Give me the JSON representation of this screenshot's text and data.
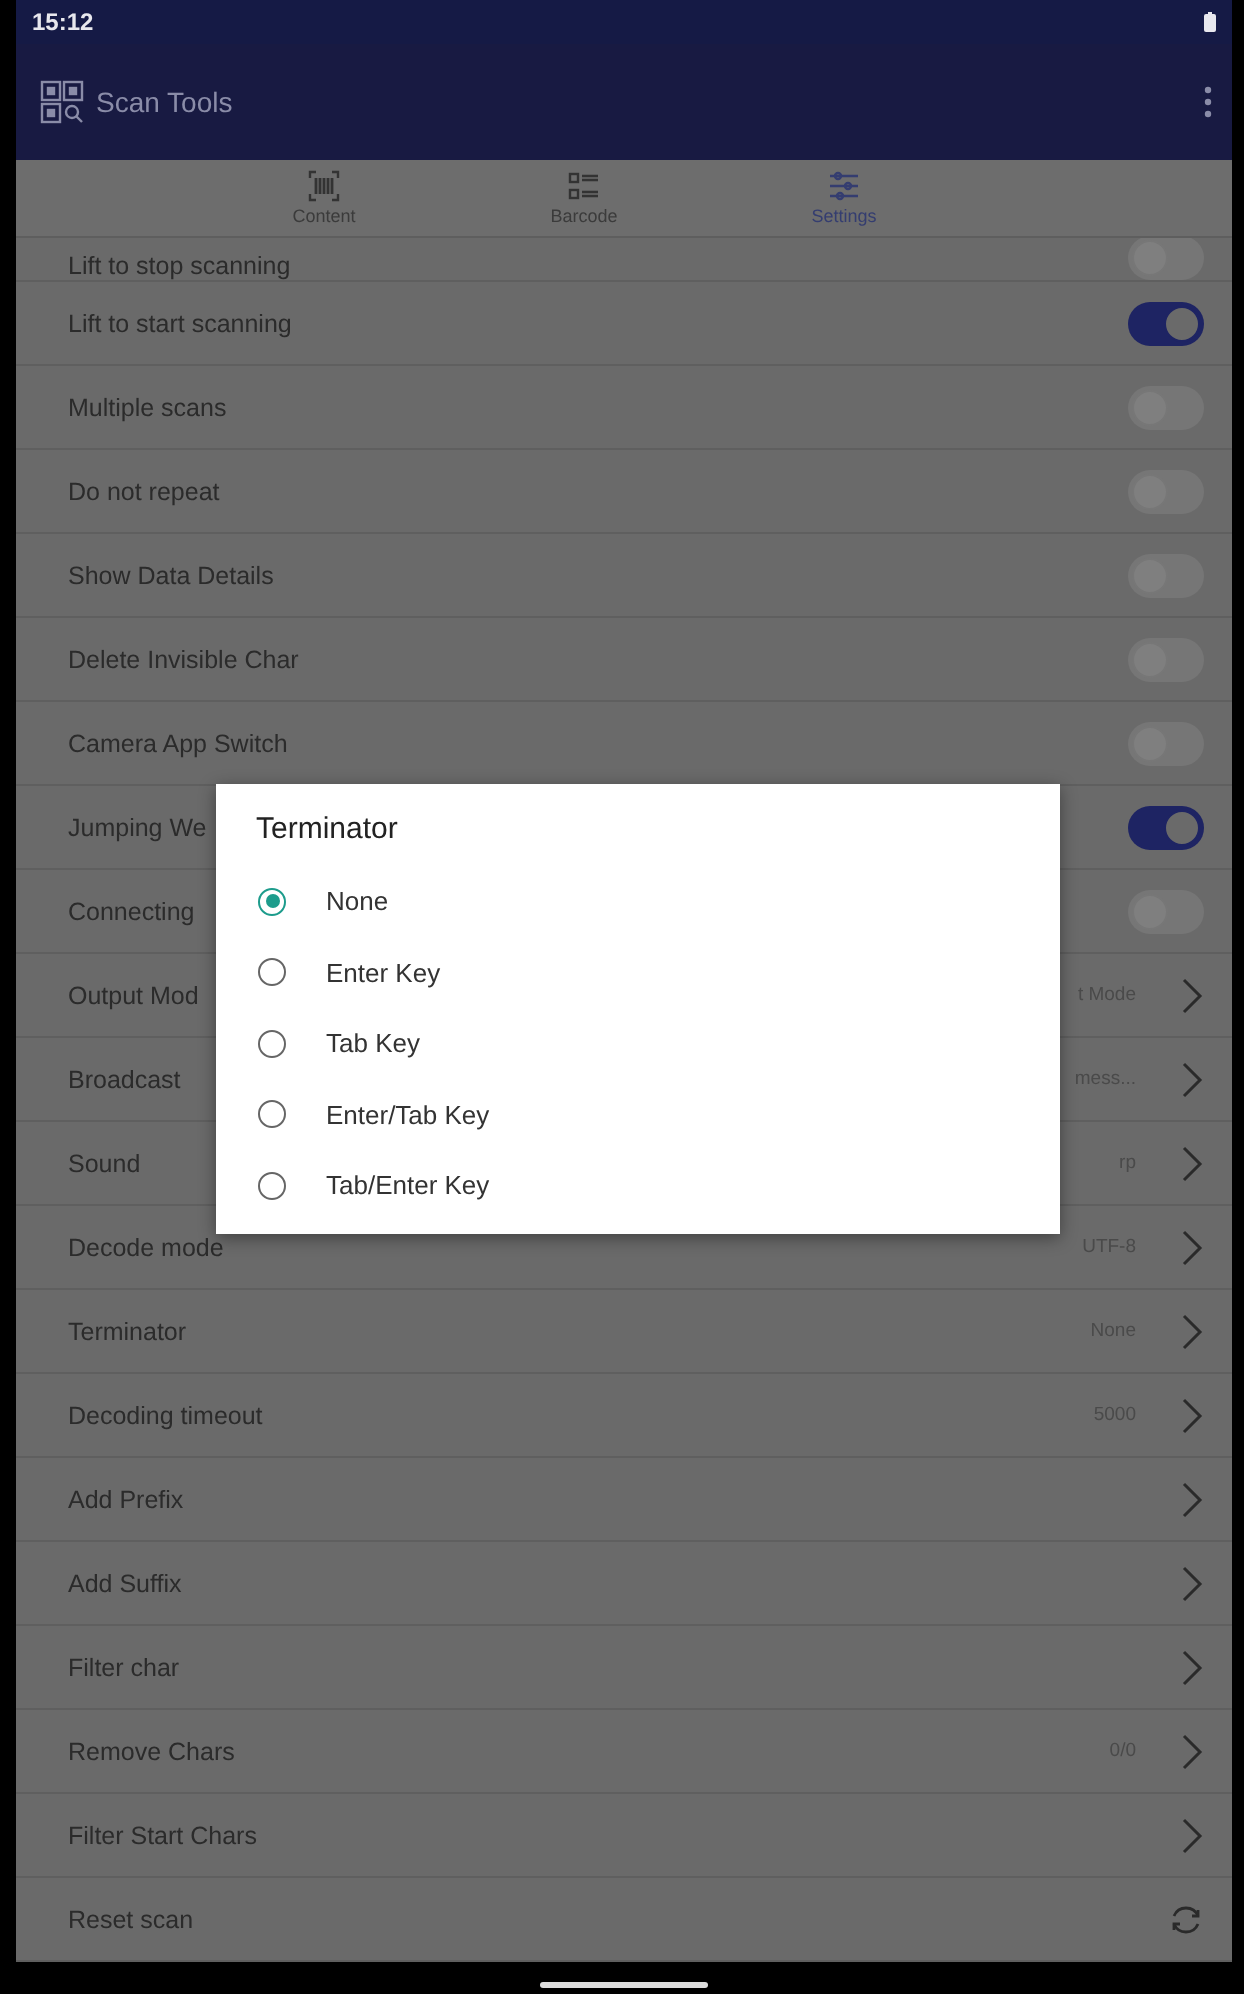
{
  "status_bar": {
    "time": "15:12"
  },
  "app_bar": {
    "title": "Scan Tools"
  },
  "tabs": [
    {
      "label": "Content",
      "kind": "scan",
      "selected": false
    },
    {
      "label": "Barcode",
      "kind": "list",
      "selected": false
    },
    {
      "label": "Settings",
      "kind": "sliders",
      "selected": true
    }
  ],
  "settings": [
    {
      "label": "Lift to stop scanning",
      "kind": "toggle",
      "on": false
    },
    {
      "label": "Lift to start scanning",
      "kind": "toggle",
      "on": true
    },
    {
      "label": "Multiple scans",
      "kind": "toggle",
      "on": false
    },
    {
      "label": "Do not repeat",
      "kind": "toggle",
      "on": false
    },
    {
      "label": "Show Data Details",
      "kind": "toggle",
      "on": false
    },
    {
      "label": "Delete Invisible Char",
      "kind": "toggle",
      "on": false
    },
    {
      "label": "Camera App Switch",
      "kind": "toggle",
      "on": false
    },
    {
      "label": "Jumping We",
      "kind": "toggle",
      "on": true
    },
    {
      "label": "Connecting",
      "kind": "toggle",
      "on": false
    },
    {
      "label": "Output Mod",
      "kind": "link",
      "value": "t Mode"
    },
    {
      "label": "Broadcast",
      "kind": "link",
      "value": "mess..."
    },
    {
      "label": "Sound",
      "kind": "link",
      "value": "rp"
    },
    {
      "label": "Decode mode",
      "kind": "link",
      "value": "UTF-8"
    },
    {
      "label": "Terminator",
      "kind": "link",
      "value": "None"
    },
    {
      "label": "Decoding timeout",
      "kind": "link",
      "value": "5000"
    },
    {
      "label": "Add Prefix",
      "kind": "link"
    },
    {
      "label": "Add Suffix",
      "kind": "link"
    },
    {
      "label": "Filter char",
      "kind": "link"
    },
    {
      "label": "Remove Chars",
      "kind": "link",
      "value": "0/0"
    },
    {
      "label": "Filter Start Chars",
      "kind": "link"
    },
    {
      "label": "Reset scan",
      "kind": "reset"
    }
  ],
  "dialog": {
    "title": "Terminator",
    "options": [
      {
        "label": "None",
        "selected": true
      },
      {
        "label": "Enter Key",
        "selected": false
      },
      {
        "label": "Tab Key",
        "selected": false
      },
      {
        "label": "Enter/Tab Key",
        "selected": false
      },
      {
        "label": "Tab/Enter Key",
        "selected": false
      }
    ]
  }
}
